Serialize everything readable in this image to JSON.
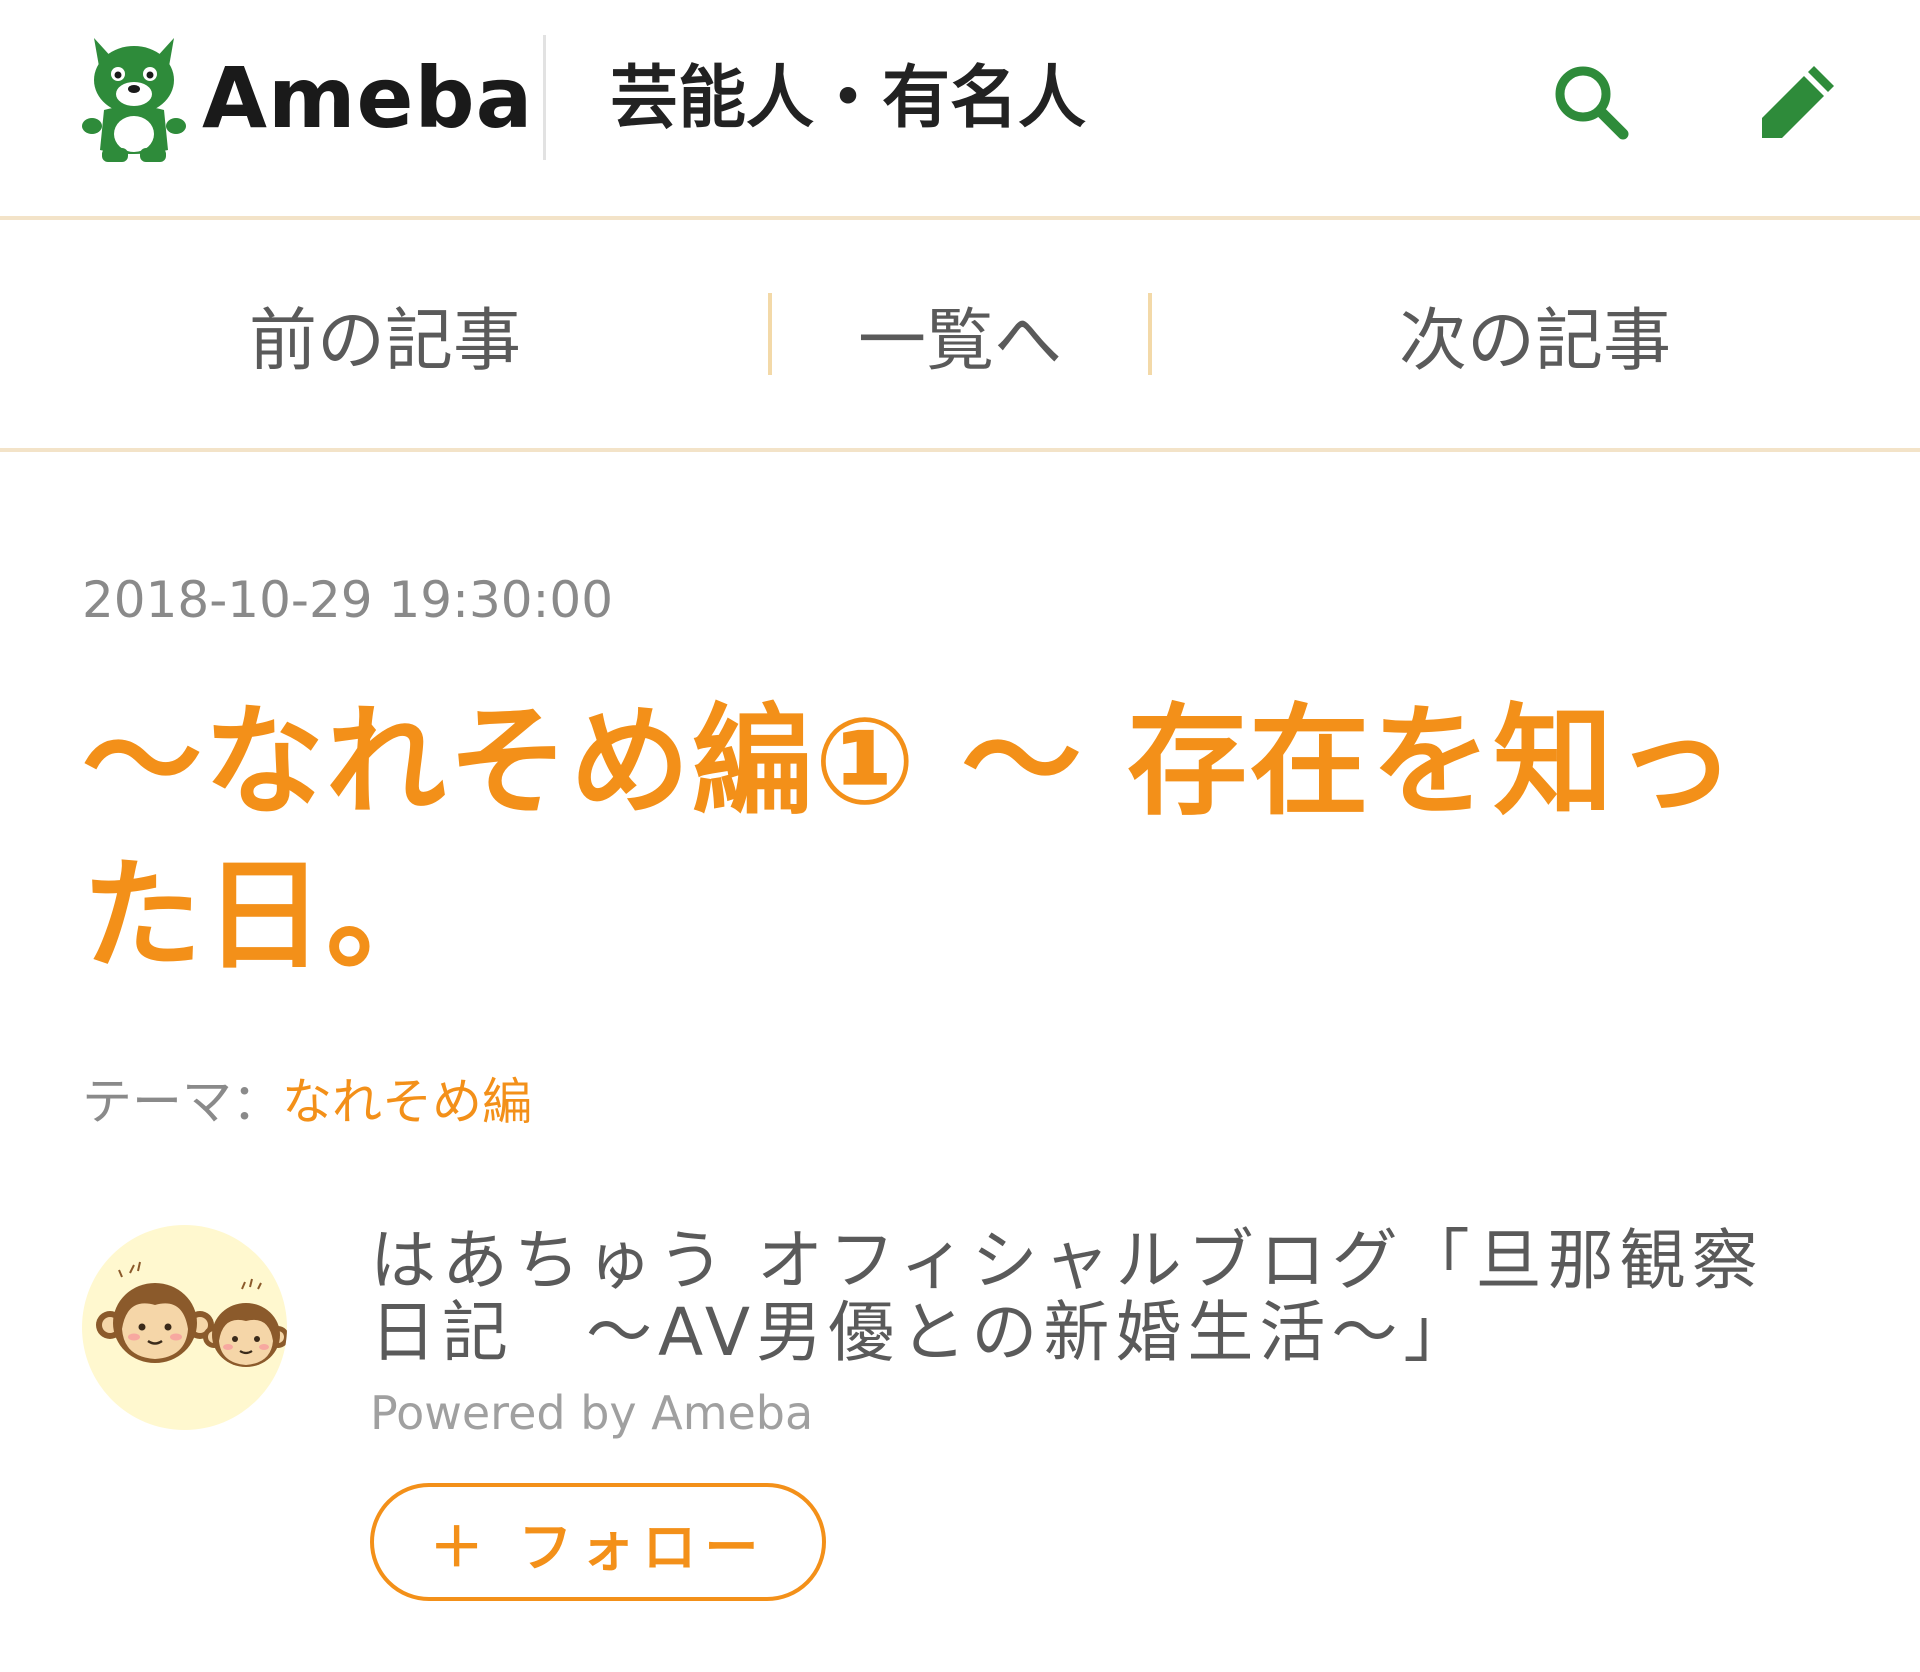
{
  "header": {
    "logo_text": "Ameba",
    "category": "芸能人・有名人",
    "search_icon": "search-icon",
    "edit_icon": "pencil-icon"
  },
  "article_nav": {
    "prev_label": "前の記事",
    "list_label": "一覧へ",
    "next_label": "次の記事"
  },
  "article": {
    "date": "2018-10-29 19:30:00",
    "title": "〜なれそめ編① 〜 存在を知った日。",
    "theme_label": "テーマ：",
    "theme_value": "なれそめ編"
  },
  "blog": {
    "title": "はあちゅう オフィシャルブログ「旦那観察日記　〜AV男優との新婚生活〜」",
    "powered_by": "Powered by Ameba",
    "follow_label": "＋ フォロー"
  },
  "colors": {
    "brand_green": "#2e8b3a",
    "accent_orange": "#f39019",
    "divider_beige": "#f3e3c8"
  }
}
